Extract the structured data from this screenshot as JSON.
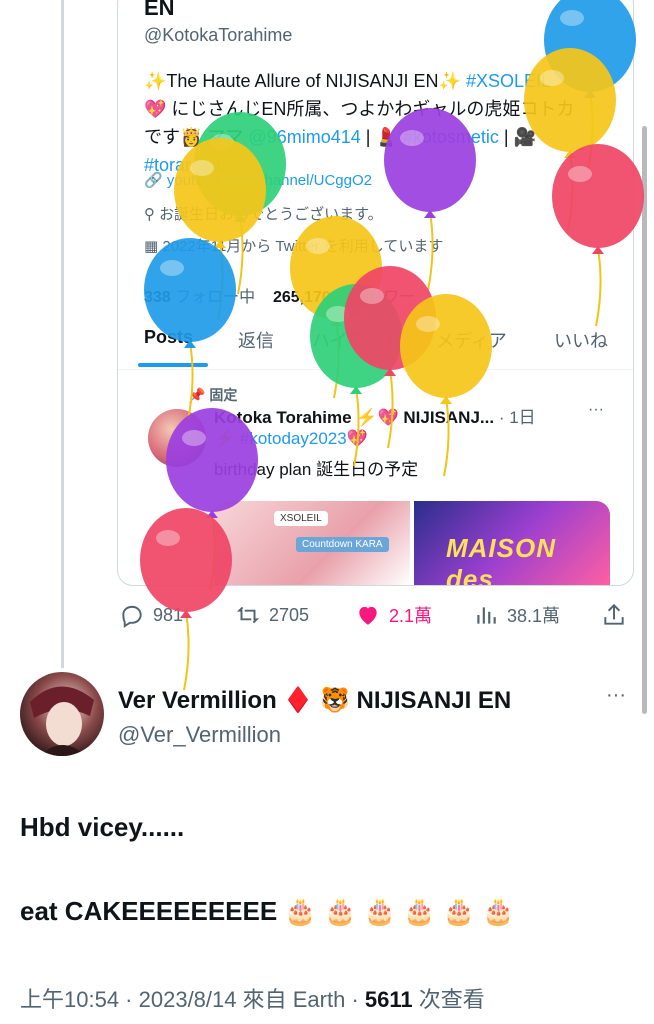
{
  "quote": {
    "name": "EN",
    "handle": "@KotokaTorahime",
    "bio_line1_pre": "✨The Haute Allure of NIJISANJI EN✨ ",
    "bio_line1_tag": "#XSOLEIL",
    "bio_line2": "💖 にじさんじEN所属、つよかわギャルの虎姫コトカ",
    "bio_line3_pre": "です👸 ママ ",
    "bio_line3_link": "@96mimo414",
    "bio_line3_mid": " | 💄 ",
    "bio_line3_tag": "#kotosmetic",
    "bio_line3_post": " | 🎥",
    "bio_line4_tag": "#toraroom",
    "website": "youtube.com/channel/UCggO2",
    "birthday": "お誕生日おめでとうございます。",
    "joined": "2022年11月から Twitter を利用しています",
    "following_count": "338",
    "following_label": "フォロー中",
    "followers_count": "265,170",
    "followers_label": "フォロワー",
    "tabs": [
      "Posts",
      "返信",
      "ハイライト",
      "メディア",
      "いいね"
    ],
    "pinned_label": "固定",
    "post_author": "Kotoka Torahime ⚡️💖 NIJISANJ...",
    "post_time": "· 1日",
    "post_more": "···",
    "post_line1": "⚡️ #kotoday2023💖",
    "post_line2": "birthday plan 誕生日の予定",
    "media1_tag": "XSOLEIL",
    "media1_tag2": "Countdown KARA",
    "media2_brand": "MAISON des"
  },
  "actions": {
    "replies": "981",
    "retweets": "2705",
    "likes": "2.1萬",
    "views": "38.1萬"
  },
  "colors": {
    "accent": "#1d9bf0",
    "like": "#f91880",
    "muted": "#536471"
  },
  "tweet": {
    "display_name": "Ver Vermillion",
    "name_emojis": "♦️ 🐯",
    "name_suffix": "NIJISANJI EN",
    "handle": "@Ver_Vermillion",
    "more": "···",
    "line1": "Hbd vicey......",
    "line2": "eat CAKEEEEEEEEE 🎂 🎂 🎂 🎂 🎂 🎂",
    "time": "上午10:54",
    "date": "2023/8/14",
    "source_label": "來自 Earth",
    "views_count": "5611",
    "views_label": "次查看"
  },
  "balloon_colors": [
    "#1e9be8",
    "#f5c518",
    "#2fcf7a",
    "#9b3fe0",
    "#ef4565"
  ]
}
